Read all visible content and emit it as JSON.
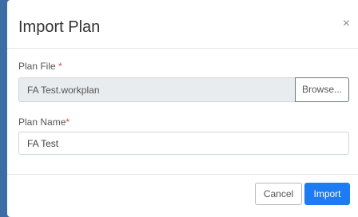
{
  "dialog": {
    "title": "Import Plan",
    "close_glyph": "×"
  },
  "plan_file": {
    "label": "Plan File",
    "required_mark": "*",
    "value": "FA Test.workplan",
    "browse_label": "Browse..."
  },
  "plan_name": {
    "label": "Plan Name",
    "required_mark": "*",
    "value": "FA Test"
  },
  "footer": {
    "cancel_label": "Cancel",
    "import_label": "Import"
  },
  "colors": {
    "backdrop": "#3c6da5",
    "primary": "#1e7cf2",
    "required": "#e0473a"
  },
  "icons": {
    "close": "close-icon"
  }
}
